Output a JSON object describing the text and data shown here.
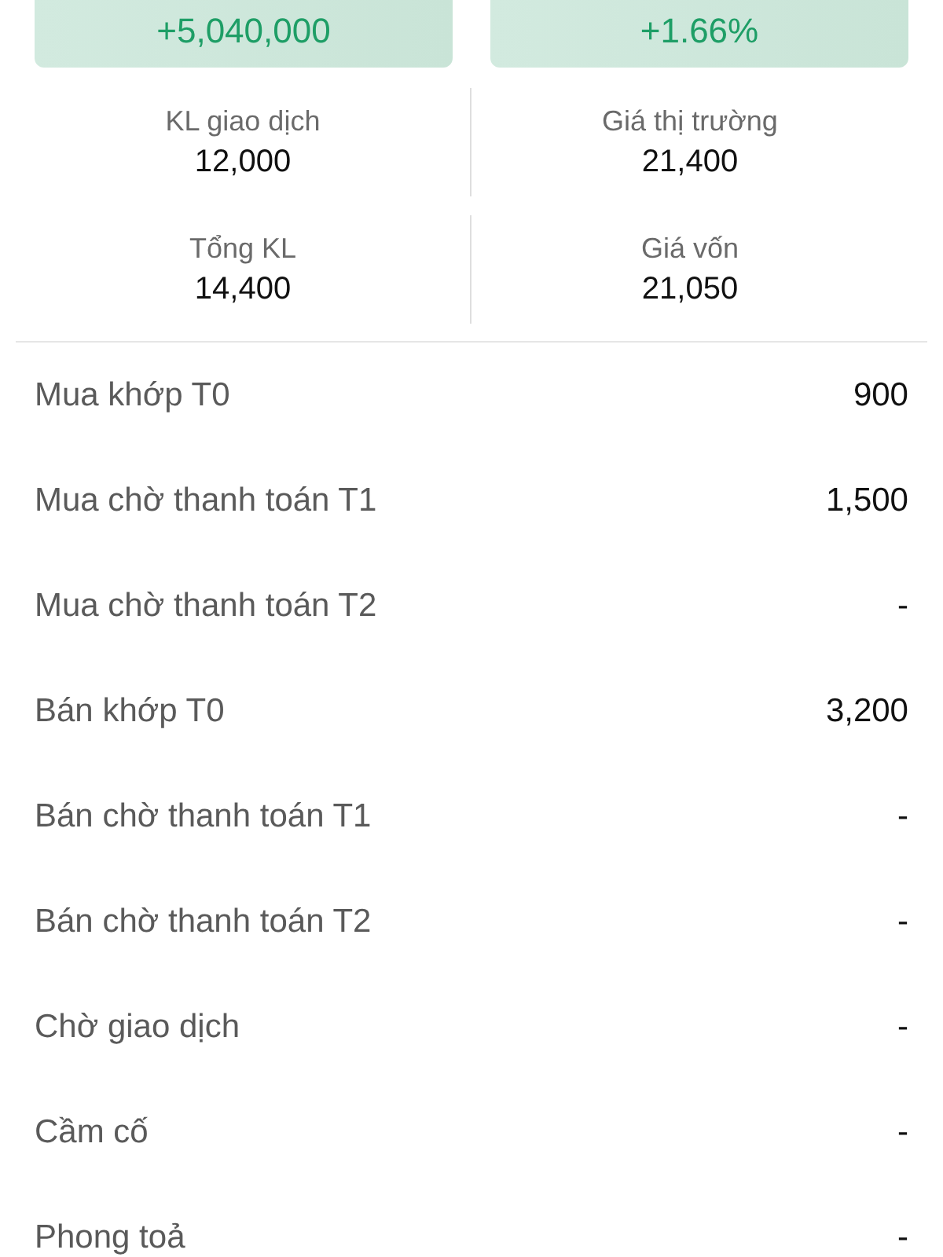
{
  "summary_cards": [
    {
      "value": "+5,040,000"
    },
    {
      "value": "+1.66%"
    }
  ],
  "stats": [
    {
      "label": "KL giao dịch",
      "value": "12,000"
    },
    {
      "label": "Giá thị trường",
      "value": "21,400"
    },
    {
      "label": "Tổng KL",
      "value": "14,400"
    },
    {
      "label": "Giá vốn",
      "value": "21,050"
    }
  ],
  "rows": [
    {
      "label": "Mua khớp T0",
      "value": "900"
    },
    {
      "label": "Mua chờ thanh toán T1",
      "value": "1,500"
    },
    {
      "label": "Mua chờ thanh toán T2",
      "value": "-"
    },
    {
      "label": "Bán khớp T0",
      "value": "3,200"
    },
    {
      "label": "Bán chờ thanh toán T1",
      "value": "-"
    },
    {
      "label": "Bán chờ thanh toán T2",
      "value": "-"
    },
    {
      "label": "Chờ giao dịch",
      "value": "-"
    },
    {
      "label": "Cầm cố",
      "value": "-"
    },
    {
      "label": "Phong toả",
      "value": "-"
    }
  ]
}
